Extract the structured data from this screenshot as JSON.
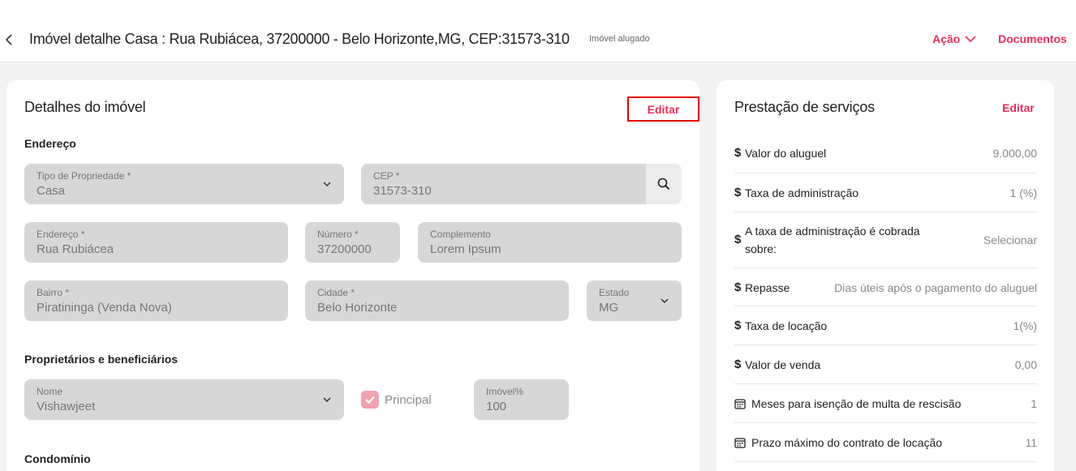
{
  "header": {
    "back_icon": "chevron-left-icon",
    "title": "Imóvel detalhe  Casa : Rua Rubiácea, 37200000 - Belo Horizonte,MG, CEP:31573-310",
    "status": "Imóvel alugado",
    "acao_label": "Ação",
    "documentos_label": "Documentos",
    "accent_color": "#e8305a"
  },
  "property": {
    "title": "Detalhes do imóvel",
    "edit_label": "Editar",
    "address_section": "Endereço",
    "fields": {
      "tipo": {
        "label": "Tipo de Propriedade *",
        "value": "Casa"
      },
      "cep": {
        "label": "CEP *",
        "value": "31573-310"
      },
      "endereco": {
        "label": "Endereço *",
        "value": "Rua Rubiácea"
      },
      "numero": {
        "label": "Número *",
        "value": "37200000"
      },
      "complemento": {
        "label": "Complemento",
        "value": "Lorem Ipsum"
      },
      "bairro": {
        "label": "Bairro *",
        "value": "Piratininga (Venda Nova)"
      },
      "cidade": {
        "label": "Cidade *",
        "value": "Belo Horizonte"
      },
      "estado": {
        "label": "Estado",
        "value": "MG"
      }
    },
    "owners_section": "Proprietários e beneficiários",
    "owner": {
      "nome_label": "Nome",
      "nome_value": "Vishawjeet",
      "principal_label": "Principal",
      "principal_checked": true,
      "percent_label": "Imóvel%",
      "percent_value": "100"
    },
    "condominio_section": "Condomínio"
  },
  "services": {
    "title": "Prestação de serviços",
    "edit_label": "Editar",
    "rows": [
      {
        "icon": "$",
        "label": "Valor do aluguel",
        "value": "9.000,00"
      },
      {
        "icon": "$",
        "label": "Taxa de administração",
        "value": "1 (%)"
      },
      {
        "icon": "$",
        "label": "A taxa de administração é cobrada",
        "label2": "sobre:",
        "value": "Selecionar"
      },
      {
        "icon": "$",
        "label": "Repasse",
        "value": "Dias úteis após o pagamento do aluguel"
      },
      {
        "icon": "$",
        "label": "Taxa de locação",
        "value": "1(%)"
      },
      {
        "icon": "$",
        "label": "Valor de venda",
        "value": "0,00"
      },
      {
        "icon": "calendar-icon",
        "label": "Meses para isenção de multa de rescisão",
        "value": "1"
      },
      {
        "icon": "calendar-icon",
        "label": "Prazo máximo do contrato de locação",
        "value": "11"
      }
    ]
  }
}
